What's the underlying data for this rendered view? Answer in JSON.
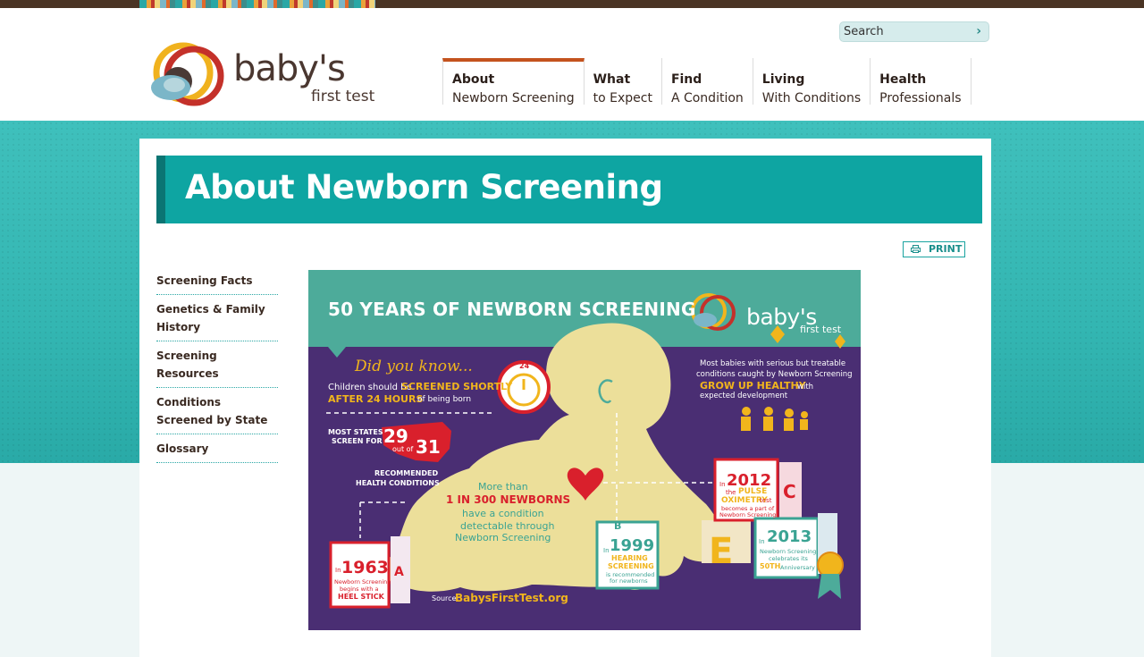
{
  "brand": {
    "logo_word": "baby's",
    "logo_sub": "first test",
    "colors": {
      "teal": "#0ea5a2",
      "dark_teal": "#0b7573",
      "brown": "#4a3424",
      "orange": "#c4531e",
      "purple": "#4a2e73"
    }
  },
  "search": {
    "placeholder": "Search",
    "button_icon": "chevron-right-icon",
    "button_glyph": "›"
  },
  "nav": {
    "items": [
      {
        "line1": "About",
        "line2": "Newborn Screening",
        "active": true
      },
      {
        "line1": "What",
        "line2": "to Expect"
      },
      {
        "line1": "Find",
        "line2": "A Condition"
      },
      {
        "line1": "Living",
        "line2": "With Conditions"
      },
      {
        "line1": "Health",
        "line2": "Professionals"
      }
    ]
  },
  "page": {
    "title": "About Newborn Screening",
    "print_label": "PRINT"
  },
  "sidebar": {
    "items": [
      {
        "label": "Screening Facts"
      },
      {
        "label": "Genetics & Family History"
      },
      {
        "label": "Screening Resources"
      },
      {
        "label": "Conditions Screened by State"
      },
      {
        "label": "Glossary"
      }
    ]
  },
  "infographic": {
    "title": "50 YEARS OF NEWBORN SCREENING",
    "logo_word": "baby's",
    "logo_sub": "first test",
    "did_you_know": "Did you know...",
    "screen1": "Children should be",
    "screen_hl1": "SCREENED SHORTLY",
    "screen_hl2": "AFTER 24 HOURS",
    "screen2": "of being born",
    "clock_label": "24",
    "states1": "MOST STATES",
    "states2": "SCREEN FOR",
    "states_num1": "29",
    "states_of": "out of",
    "states_num2": "31",
    "states3": "RECOMMENDED",
    "states4": "HEALTH CONDITIONS",
    "healthy1": "Most babies with serious but treatable",
    "healthy2": "conditions caught by Newborn Screening",
    "healthy_hl": "GROW UP HEALTHY",
    "healthy3": "with",
    "healthy4": "expected development",
    "more_than": "More than",
    "newborns_hl": "1 IN 300 NEWBORNS",
    "newborns2": "have a condition",
    "newborns3": "detectable through",
    "newborns4": "Newborn Screening",
    "y1963": "1963",
    "y1963_in": "In",
    "y1963_t1": "Newborn Screening",
    "y1963_t2": "begins with a",
    "y1963_hl": "HEEL STICK",
    "y1999": "1999",
    "y1999_in": "In",
    "y1999_hl1": "HEARING",
    "y1999_hl2": "SCREENING",
    "y1999_t1": "is recommended",
    "y1999_t2": "for newborns",
    "y2012": "2012",
    "y2012_in": "In",
    "y2012_the": "the",
    "y2012_hl1": "PULSE",
    "y2012_hl2": "OXIMETRY",
    "y2012_test": "test",
    "y2012_t1": "becomes a part of",
    "y2012_t2": "Newborn Screening",
    "y2013": "2013",
    "y2013_in": "In",
    "y2013_t1": "Newborn Screening",
    "y2013_t2": "celebrates its",
    "y2013_hl": "50TH",
    "y2013_t3": "Anniversary",
    "block_a": "A",
    "block_b": "B",
    "block_c": "C",
    "block_e": "E",
    "source_label": "Source:",
    "source": "BabysFirstTest.org"
  }
}
